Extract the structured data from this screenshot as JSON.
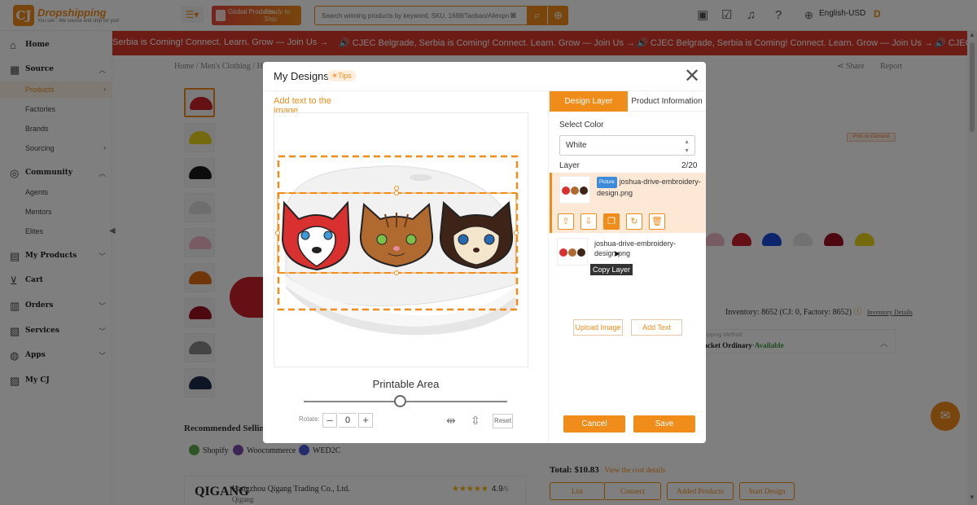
{
  "header": {
    "logo_text": "Dropshipping",
    "logo_sub": "You sell - We source and ship for you!",
    "promo_left": "Global Products",
    "promo_right": "Ready to Ship",
    "search_placeholder": "Search winning products by keyword, SKU, 1688/Taobao/Aliexpress",
    "language": "English-USD",
    "avatar": "D"
  },
  "sidebar": {
    "sections": [
      {
        "label": "Home"
      },
      {
        "label": "Source"
      },
      {
        "label": "Community"
      },
      {
        "label": "My Products"
      },
      {
        "label": "Cart"
      },
      {
        "label": "Orders"
      },
      {
        "label": "Services"
      },
      {
        "label": "Apps"
      },
      {
        "label": "My CJ"
      }
    ],
    "source_items": [
      "Products",
      "Factories",
      "Brands",
      "Sourcing"
    ],
    "community_items": [
      "Agents",
      "Mentors",
      "Elites"
    ]
  },
  "ticker": {
    "items": [
      "Serbia is Coming! Connect. Learn. Grow — Join Us →",
      "🔊 CJEC Belgrade, Serbia is Coming! Connect. Learn. Grow — Join Us →",
      "🔊 CJEC Belgrade, Serbia is Coming! Connect. Learn. Grow — Join Us →",
      "🔊 CJEC"
    ]
  },
  "page": {
    "breadcrumb": "Home / Men's Clothing / Hats",
    "share": "Share",
    "report": "Report",
    "print_tag": "Print on Demand",
    "recommended_title": "Recommended Selling",
    "platforms": [
      "Shopify",
      "Woocommerce",
      "WED2C"
    ],
    "supplier_name": "Hangzhou Qigang Trading Co., Ltd.",
    "supplier_sub": "Qigang",
    "supplier_logo": "QIGANG",
    "rating_stars": "★★★★★",
    "rating": "4.9",
    "rating_max": "/5",
    "inventory": "Inventory: 8652",
    "inventory_detail": "(CJ: 0, Factory: 8652)",
    "inventory_link": "Inventory Details",
    "ship_method_label": "Shipping Method",
    "ship_method": "Packet Ordinary",
    "ship_available": "·Available",
    "total_label": "Total:",
    "total_value": "$10.83",
    "cost_details": "View the cost details",
    "btn_list": "List",
    "btn_connect": "Connect",
    "btn_added": "Added Products",
    "btn_design": "Start Design"
  },
  "modal": {
    "title": "My Designs",
    "tips": "Tips",
    "add_text_tab": "Add text to the image",
    "printable_area": "Printable Area",
    "rotate_label": "Rotate:",
    "rotate_value": "0",
    "reset": "Reset",
    "tab_design_layer": "Design Layer",
    "tab_product_info": "Product Information",
    "select_color_label": "Select Color",
    "selected_color": "White",
    "layer_label": "Layer",
    "layer_count": "2/20",
    "layers": [
      {
        "badge": "Picture",
        "name": "joshua-drive-embroidery-design.png"
      },
      {
        "name": "joshua-drive-embroidery-design.png"
      }
    ],
    "tooltip": "Copy Layer",
    "upload_image": "Upload Image",
    "add_text": "Add Text",
    "cancel": "Cancel",
    "save": "Save"
  },
  "colors": {
    "accent": "#f08c1a",
    "ticker_bg": "#d8382b",
    "badge_blue": "#3d8bd9"
  }
}
